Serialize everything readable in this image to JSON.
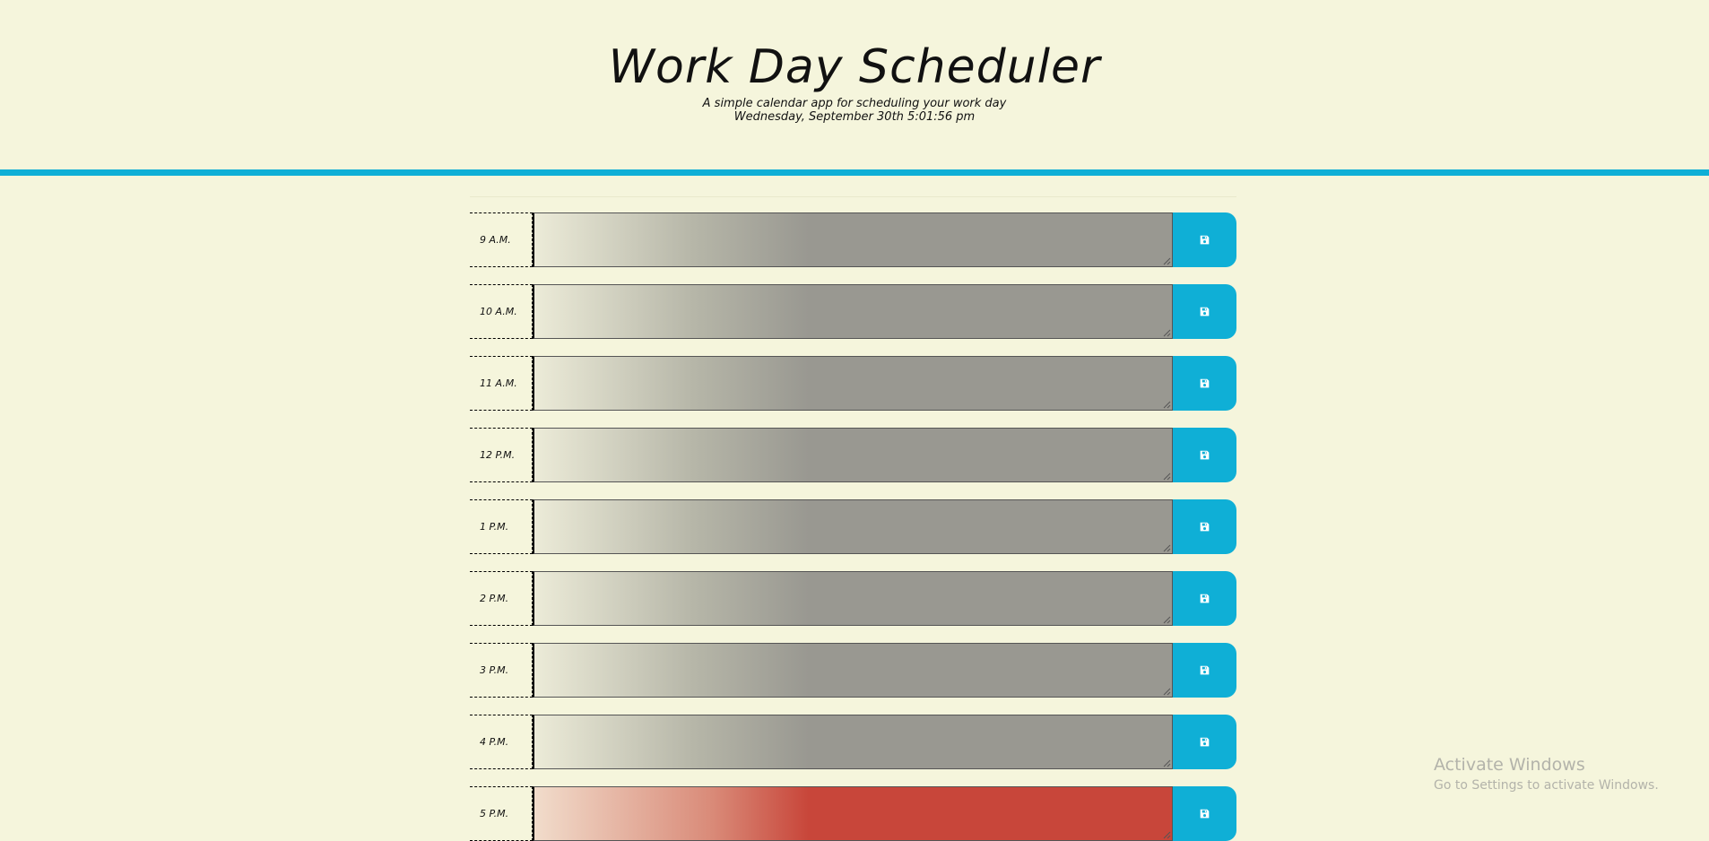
{
  "header": {
    "title": "Work Day Scheduler",
    "subtitle": "A simple calendar app for scheduling your work day",
    "current_day": "Wednesday, September 30th 5:01:56 pm"
  },
  "time_blocks": [
    {
      "hour": "9 A.M.",
      "text": "",
      "state": "past"
    },
    {
      "hour": "10 A.M.",
      "text": "",
      "state": "past"
    },
    {
      "hour": "11 A.M.",
      "text": "",
      "state": "past"
    },
    {
      "hour": "12 P.M.",
      "text": "",
      "state": "past"
    },
    {
      "hour": "1 P.M.",
      "text": "",
      "state": "past"
    },
    {
      "hour": "2 P.M.",
      "text": "",
      "state": "past"
    },
    {
      "hour": "3 P.M.",
      "text": "",
      "state": "past"
    },
    {
      "hour": "4 P.M.",
      "text": "",
      "state": "past"
    },
    {
      "hour": "5 P.M.",
      "text": "",
      "state": "present"
    }
  ],
  "save_icon": "floppy-disk-icon",
  "colors": {
    "accent": "#0fafd6",
    "background": "#f5f5dc",
    "past": "#999891",
    "present": "#c8463a"
  },
  "watermark": {
    "title": "Activate Windows",
    "subtitle": "Go to Settings to activate Windows."
  }
}
